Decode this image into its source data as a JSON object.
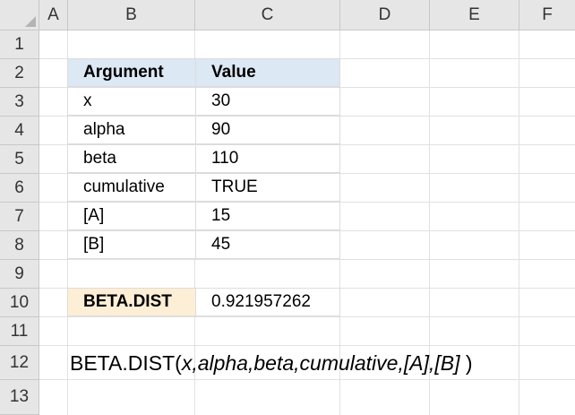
{
  "columns": [
    "A",
    "B",
    "C",
    "D",
    "E",
    "F"
  ],
  "rows": [
    "1",
    "2",
    "3",
    "4",
    "5",
    "6",
    "7",
    "8",
    "9",
    "10",
    "11",
    "12",
    "13"
  ],
  "table": {
    "header": {
      "argument": "Argument",
      "value": "Value"
    },
    "rows": [
      {
        "argument": "x",
        "value": "30"
      },
      {
        "argument": "alpha",
        "value": "90"
      },
      {
        "argument": "beta",
        "value": "110"
      },
      {
        "argument": "cumulative",
        "value": "TRUE"
      },
      {
        "argument": "[A]",
        "value": "15"
      },
      {
        "argument": "[B]",
        "value": "45"
      }
    ]
  },
  "result": {
    "label": "BETA.DIST",
    "value": "0.921957262"
  },
  "formula": {
    "name": "BETA.DIST(",
    "args": "x,alpha,beta,cumulative,[A],[B]",
    "close": " )"
  },
  "colors": {
    "header_fill": "#dce8f3",
    "result_label_fill": "#fdefd5",
    "grid_header_fill": "#e6e6e6"
  }
}
